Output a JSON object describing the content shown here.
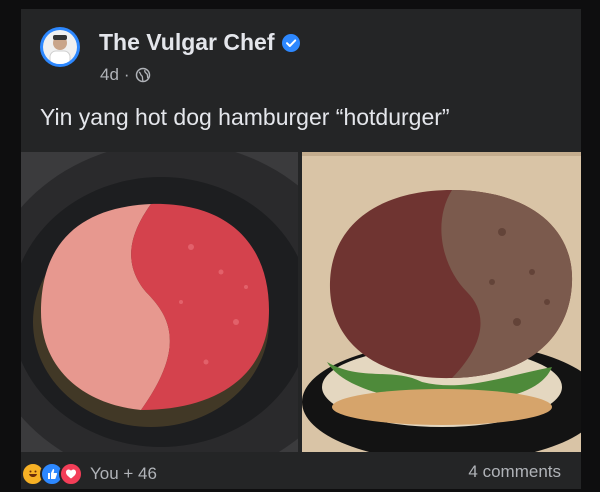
{
  "post": {
    "author": "The Vulgar Chef",
    "time": "4d",
    "separator": "·",
    "caption": "Yin yang hot dog hamburger “hotdurger”",
    "reaction_count": "You + 46",
    "comments": "4 comments"
  },
  "icons": {
    "verified": "verified-badge-icon",
    "audience": "globe-icon",
    "reactions": [
      "haha-icon",
      "like-icon",
      "love-icon"
    ]
  },
  "colors": {
    "background": "#0e0e0f",
    "card": "#242526",
    "text": "#e4e6eb",
    "secondary_text": "#b0b3b8",
    "verified": "#2d88ff",
    "like": "#2d88ff",
    "love": "#f33e58",
    "haha": "#f7b125"
  }
}
